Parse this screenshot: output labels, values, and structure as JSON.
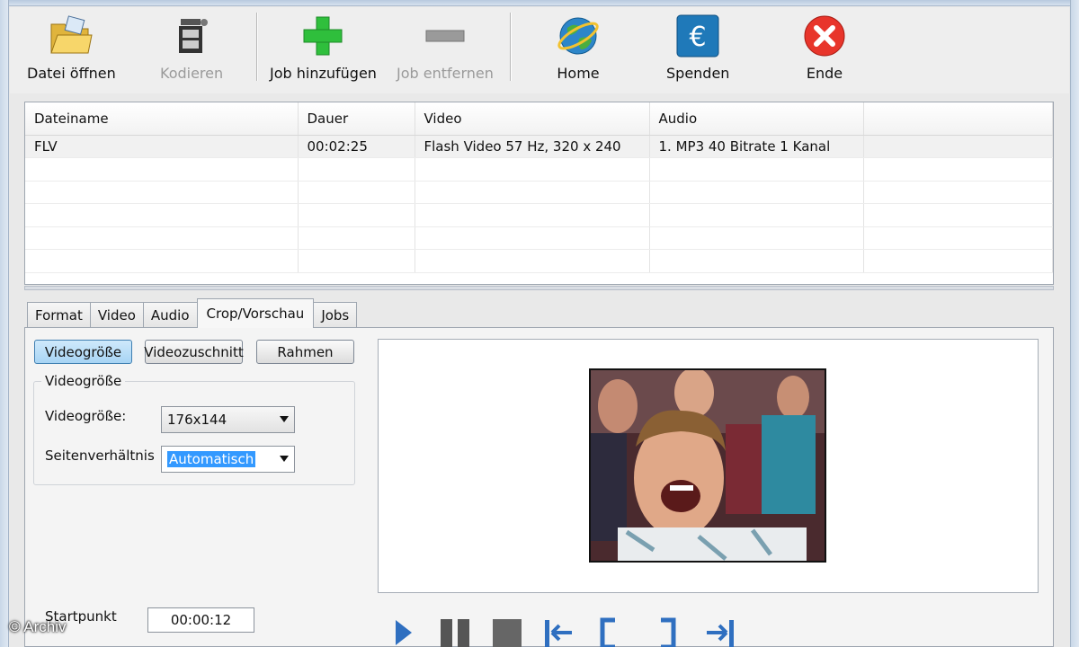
{
  "toolbar": {
    "open_label": "Datei öffnen",
    "encode_label": "Kodieren",
    "add_job_label": "Job hinzufügen",
    "remove_job_label": "Job entfernen",
    "home_label": "Home",
    "donate_label": "Spenden",
    "exit_label": "Ende"
  },
  "filelist": {
    "columns": [
      "Dateiname",
      "Dauer",
      "Video",
      "Audio"
    ],
    "rows": [
      {
        "name": "FLV",
        "duration": "00:02:25",
        "video": "Flash Video 57 Hz, 320 x 240",
        "audio": "1. MP3 40 Bitrate 1 Kanal"
      }
    ]
  },
  "tabs": [
    "Format",
    "Video",
    "Audio",
    "Crop/Vorschau",
    "Jobs"
  ],
  "active_tab": "Crop/Vorschau",
  "crop": {
    "buttons": [
      "Videogröße",
      "Videozuschnitt",
      "Rahmen"
    ],
    "group_title": "Videogröße",
    "size_label": "Videogröße:",
    "size_value": "176x144",
    "aspect_label": "Seitenverhältnis",
    "aspect_value": "Automatisch"
  },
  "playback": {
    "start_label": "Startpunkt",
    "start_value": "00:00:12"
  },
  "watermark": "© Archiv",
  "colors": {
    "accent_pressed": "#a7d4f4",
    "highlight": "#3399ff",
    "add_green": "#2fbf3c",
    "exit_red": "#e8352b",
    "control_blue": "#2f6fc0"
  }
}
